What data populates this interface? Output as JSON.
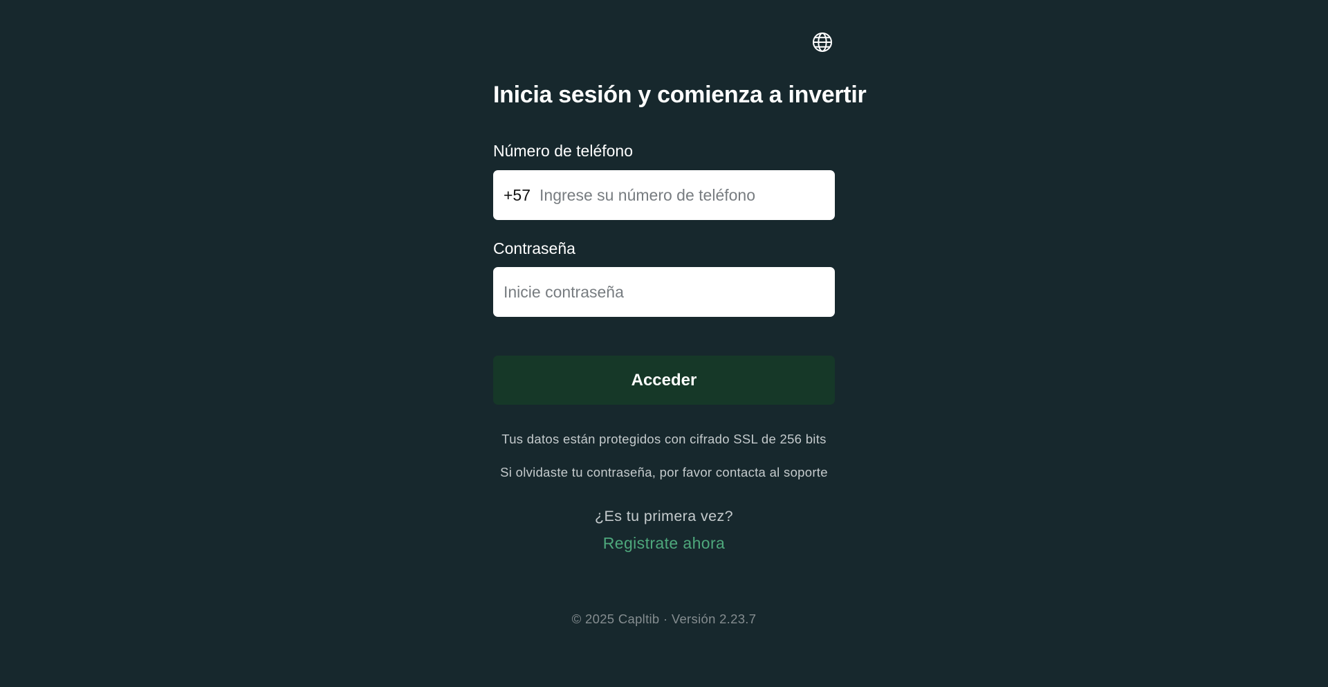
{
  "header": {
    "language_icon": "globe-icon"
  },
  "login": {
    "title": "Inicia sesión y comienza a invertir",
    "phone": {
      "label": "Número de teléfono",
      "prefix": "+57",
      "value": "",
      "placeholder": "Ingrese su número de teléfono"
    },
    "password": {
      "label": "Contraseña",
      "value": "",
      "placeholder": "Inicie contraseña"
    },
    "submit_label": "Acceder",
    "ssl_note": "Tus datos están protegidos con cifrado SSL de 256 bits",
    "support_note": "Si olvidaste tu contraseña, por favor contacta al soporte",
    "first_time_text": "¿Es tu primera vez?",
    "register_link": "Registrate ahora"
  },
  "footer": {
    "text": "© 2025 Capltib · Versión 2.23.7"
  },
  "colors": {
    "background": "#17282d",
    "button": "#163828",
    "link": "#4ea87c"
  }
}
